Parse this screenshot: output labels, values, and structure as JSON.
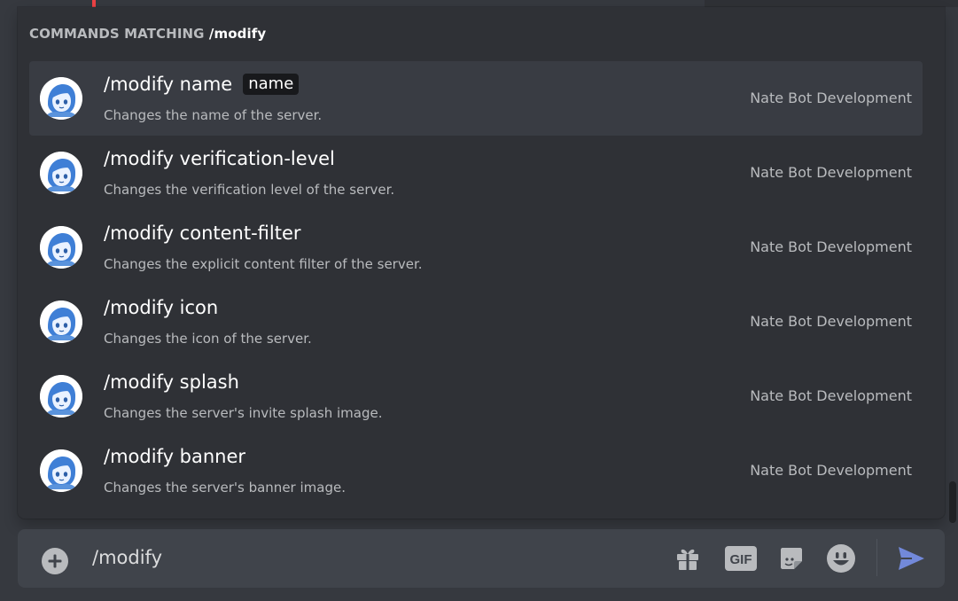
{
  "header": {
    "prefix": "COMMANDS MATCHING",
    "query": "/modify"
  },
  "commands": [
    {
      "name": "/modify name",
      "param": "name",
      "description": "Changes the name of the server.",
      "source": "Nate Bot Development"
    },
    {
      "name": "/modify verification-level",
      "param": "",
      "description": "Changes the verification level of the server.",
      "source": "Nate Bot Development"
    },
    {
      "name": "/modify content-filter",
      "param": "",
      "description": "Changes the explicit content filter of the server.",
      "source": "Nate Bot Development"
    },
    {
      "name": "/modify icon",
      "param": "",
      "description": "Changes the icon of the server.",
      "source": "Nate Bot Development"
    },
    {
      "name": "/modify splash",
      "param": "",
      "description": "Changes the server's invite splash image.",
      "source": "Nate Bot Development"
    },
    {
      "name": "/modify banner",
      "param": "",
      "description": "Changes the server's banner image.",
      "source": "Nate Bot Development"
    }
  ],
  "chat": {
    "input_value": "/modify",
    "gif_label": "GIF",
    "icons": [
      "plus-circle-icon",
      "gift-icon",
      "gif-icon",
      "sticker-icon",
      "emoji-icon",
      "send-icon"
    ]
  },
  "colors": {
    "background": "#36393f",
    "popup": "#2f3136",
    "row_active": "#393c43",
    "input_bar": "#40444b",
    "send_accent": "#7289da"
  }
}
